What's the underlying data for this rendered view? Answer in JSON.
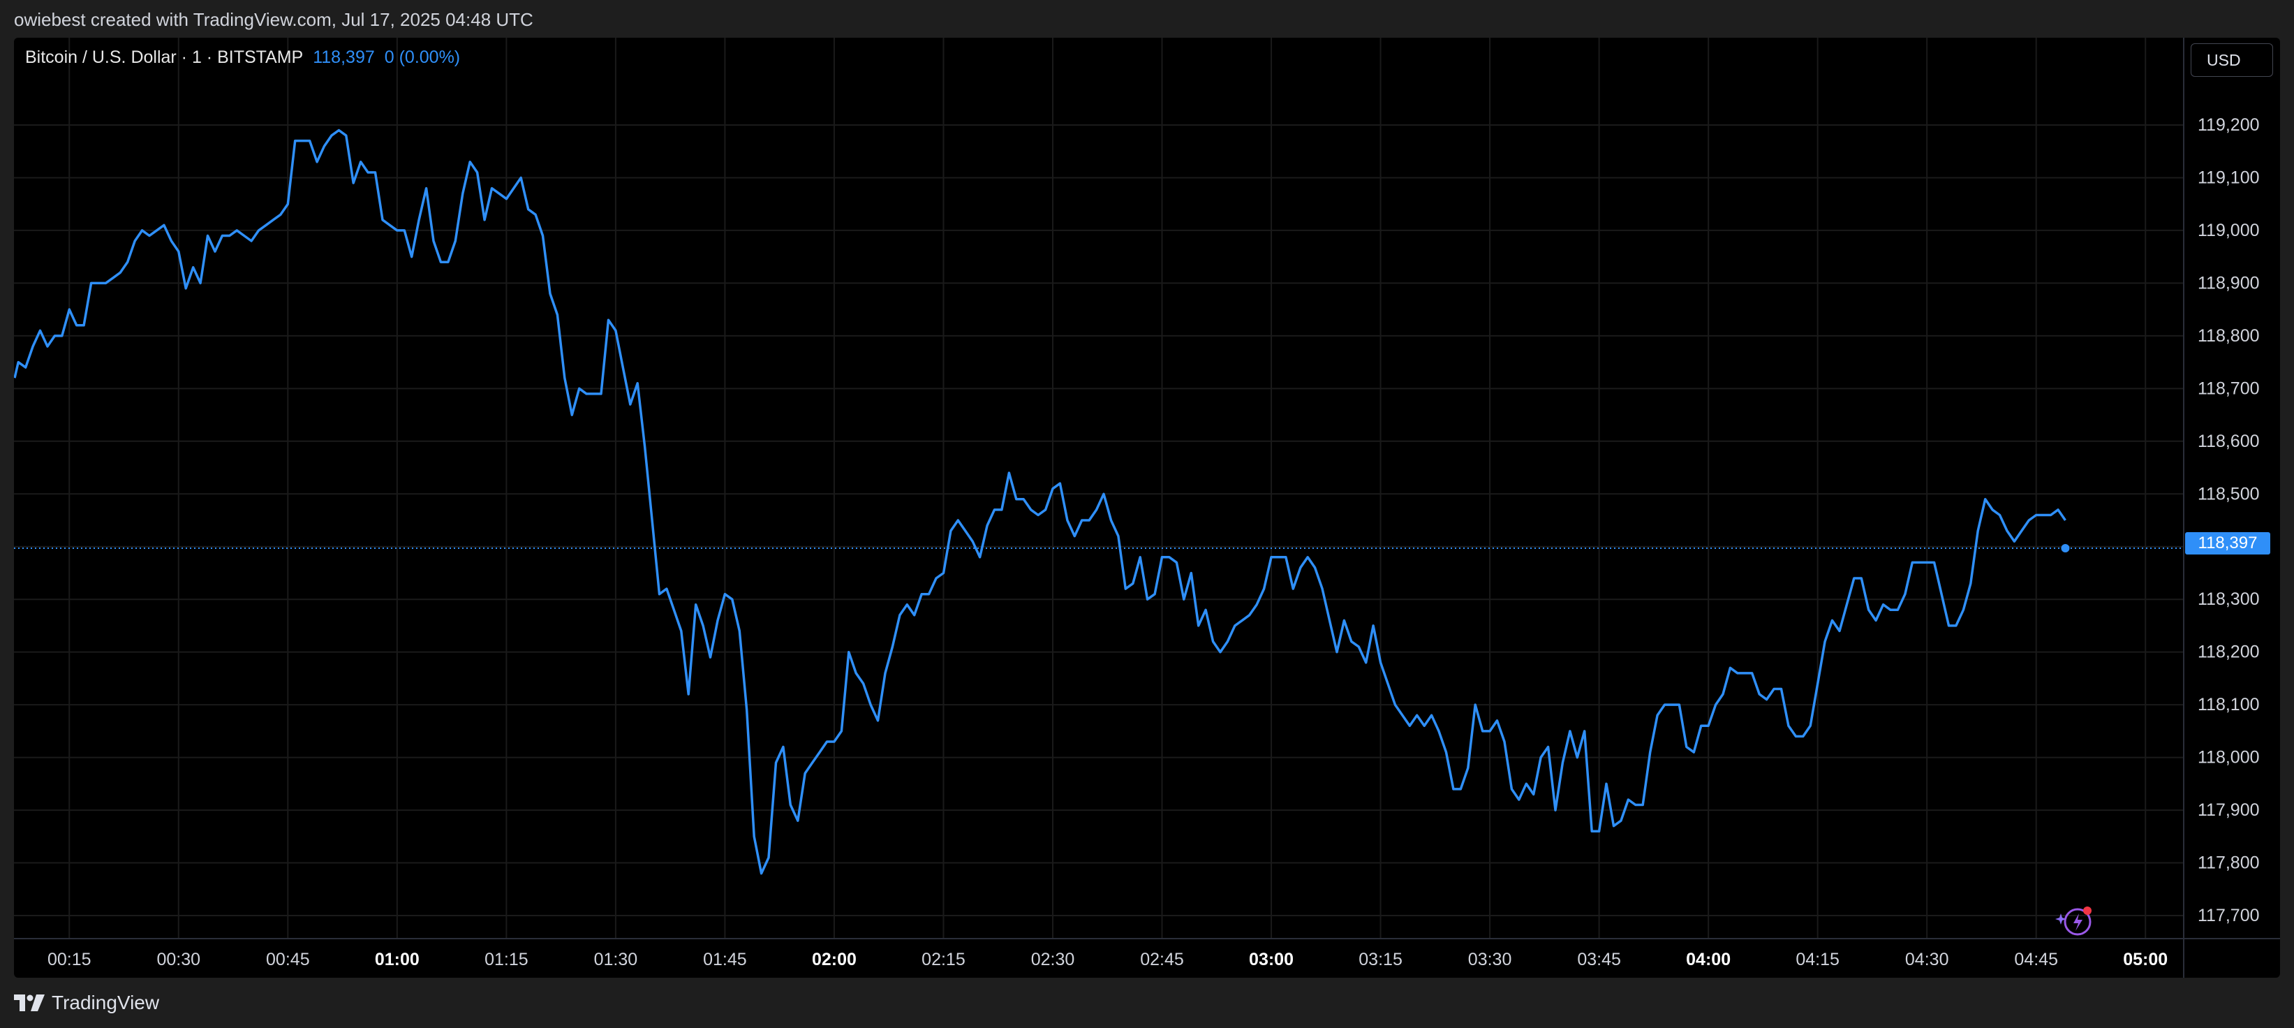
{
  "header": {
    "credit": "owiebest created with TradingView.com, Jul 17, 2025 04:48 UTC"
  },
  "legend": {
    "symbol": "Bitcoin / U.S. Dollar · 1 · BITSTAMP",
    "last_price": "118,397",
    "change": "0 (0.00%)"
  },
  "scale": {
    "currency": "USD",
    "current_price_label": "118,397"
  },
  "footer": {
    "brand": "TradingView"
  },
  "icons": [
    "tradingview-logo-icon",
    "ai-assistant-icon"
  ],
  "colors": {
    "line": "#2f8ff8",
    "background": "#000000",
    "grid": "#1a1a1a",
    "price_tag": "#2f8ff8"
  },
  "chart_data": {
    "type": "line",
    "ylim": [
      117650,
      119250
    ],
    "y_ticks": [
      117700,
      117800,
      117900,
      118000,
      118100,
      118200,
      118300,
      118400,
      118500,
      118600,
      118700,
      118800,
      118900,
      119000,
      119100,
      119200
    ],
    "y_tick_labels": [
      "117,700",
      "117,800",
      "117,900",
      "118,000",
      "118,100",
      "118,200",
      "118,300",
      "118,400",
      "118,500",
      "118,600",
      "118,700",
      "118,800",
      "118,900",
      "119,000",
      "119,100",
      "119,200"
    ],
    "x_tick_labels": [
      {
        "label": "00:15",
        "minute": 15,
        "bold": false
      },
      {
        "label": "00:30",
        "minute": 30,
        "bold": false
      },
      {
        "label": "00:45",
        "minute": 45,
        "bold": false
      },
      {
        "label": "01:00",
        "minute": 60,
        "bold": true
      },
      {
        "label": "01:15",
        "minute": 75,
        "bold": false
      },
      {
        "label": "01:30",
        "minute": 90,
        "bold": false
      },
      {
        "label": "01:45",
        "minute": 105,
        "bold": false
      },
      {
        "label": "02:00",
        "minute": 120,
        "bold": true
      },
      {
        "label": "02:15",
        "minute": 135,
        "bold": false
      },
      {
        "label": "02:30",
        "minute": 150,
        "bold": false
      },
      {
        "label": "02:45",
        "minute": 165,
        "bold": false
      },
      {
        "label": "03:00",
        "minute": 180,
        "bold": true
      },
      {
        "label": "03:15",
        "minute": 195,
        "bold": false
      },
      {
        "label": "03:30",
        "minute": 210,
        "bold": false
      },
      {
        "label": "03:45",
        "minute": 225,
        "bold": false
      },
      {
        "label": "04:00",
        "minute": 240,
        "bold": true
      },
      {
        "label": "04:15",
        "minute": 255,
        "bold": false
      },
      {
        "label": "04:30",
        "minute": 270,
        "bold": false
      },
      {
        "label": "04:45",
        "minute": 285,
        "bold": false
      },
      {
        "label": "05:00",
        "minute": 300,
        "bold": true
      }
    ],
    "xlim_minutes": [
      7.5,
      305
    ],
    "current_price": 118397,
    "series": [
      {
        "x_minutes": [
          7.5,
          8,
          9,
          10,
          11,
          12,
          13,
          14,
          15,
          16,
          17,
          18,
          19,
          20,
          21,
          22,
          23,
          24,
          25,
          26,
          27,
          28,
          29,
          30,
          31,
          32,
          33,
          34,
          35,
          36,
          37,
          38,
          39,
          40,
          41,
          42,
          43,
          44,
          45,
          46,
          47,
          48,
          49,
          50,
          51,
          52,
          53,
          54,
          55,
          56,
          57,
          58,
          59,
          60,
          61,
          62,
          63,
          64,
          65,
          66,
          67,
          68,
          69,
          70,
          71,
          72,
          73,
          74,
          75,
          76,
          77,
          78,
          79,
          80,
          81,
          82,
          83,
          84,
          85,
          86,
          87,
          88,
          89,
          90,
          91,
          92,
          93,
          94,
          95,
          96,
          97,
          98,
          99,
          100,
          101,
          102,
          103,
          104,
          105,
          106,
          107,
          108,
          109,
          110,
          111,
          112,
          113,
          114,
          115,
          116,
          117,
          118,
          119,
          120,
          121,
          122,
          123,
          124,
          125,
          126,
          127,
          128,
          129,
          130,
          131,
          132,
          133,
          134,
          135,
          136,
          137,
          138,
          139,
          140,
          141,
          142,
          143,
          144,
          145,
          146,
          147,
          148,
          149,
          150,
          151,
          152,
          153,
          154,
          155,
          156,
          157,
          158,
          159,
          160,
          161,
          162,
          163,
          164,
          165,
          166,
          167,
          168,
          169,
          170,
          171,
          172,
          173,
          174,
          175,
          176,
          177,
          178,
          179,
          180,
          181,
          182,
          183,
          184,
          185,
          186,
          187,
          188,
          189,
          190,
          191,
          192,
          193,
          194,
          195,
          196,
          197,
          198,
          199,
          200,
          201,
          202,
          203,
          204,
          205,
          206,
          207,
          208,
          209,
          210,
          211,
          212,
          213,
          214,
          215,
          216,
          217,
          218,
          219,
          220,
          221,
          222,
          223,
          224,
          225,
          226,
          227,
          228,
          229,
          230,
          231,
          232,
          233,
          234,
          235,
          236,
          237,
          238,
          239,
          240,
          241,
          242,
          243,
          244,
          245,
          246,
          247,
          248,
          249,
          250,
          251,
          252,
          253,
          254,
          255,
          256,
          257,
          258,
          259,
          260,
          261,
          262,
          263,
          264,
          265,
          266,
          267,
          268,
          269,
          270,
          271,
          272,
          273,
          274,
          275,
          276,
          277,
          278,
          279,
          280,
          281,
          282,
          283,
          284,
          285,
          286,
          287,
          288,
          289
        ],
        "values": [
          118720,
          118750,
          118740,
          118780,
          118810,
          118780,
          118800,
          118800,
          118850,
          118820,
          118820,
          118900,
          118900,
          118900,
          118910,
          118920,
          118940,
          118980,
          119000,
          118990,
          119000,
          119010,
          118980,
          118960,
          118890,
          118930,
          118900,
          118990,
          118960,
          118990,
          118990,
          119000,
          118990,
          118980,
          119000,
          119010,
          119020,
          119030,
          119050,
          119170,
          119170,
          119170,
          119130,
          119160,
          119180,
          119190,
          119180,
          119090,
          119130,
          119110,
          119110,
          119020,
          119010,
          119000,
          119000,
          118950,
          119020,
          119080,
          118980,
          118940,
          118940,
          118980,
          119070,
          119130,
          119110,
          119020,
          119080,
          119070,
          119060,
          119080,
          119100,
          119040,
          119030,
          118990,
          118880,
          118840,
          118720,
          118650,
          118700,
          118690,
          118690,
          118690,
          118830,
          118810,
          118740,
          118670,
          118710,
          118590,
          118450,
          118310,
          118320,
          118280,
          118240,
          118120,
          118290,
          118250,
          118190,
          118260,
          118310,
          118300,
          118240,
          118090,
          117850,
          117780,
          117810,
          117990,
          118020,
          117910,
          117880,
          117970,
          117990,
          118010,
          118030,
          118030,
          118050,
          118200,
          118160,
          118140,
          118100,
          118070,
          118160,
          118210,
          118270,
          118290,
          118270,
          118310,
          118310,
          118340,
          118350,
          118430,
          118450,
          118430,
          118410,
          118380,
          118440,
          118470,
          118470,
          118540,
          118490,
          118490,
          118470,
          118460,
          118470,
          118510,
          118520,
          118450,
          118420,
          118450,
          118450,
          118470,
          118500,
          118450,
          118420,
          118320,
          118330,
          118380,
          118300,
          118310,
          118380,
          118380,
          118370,
          118300,
          118350,
          118250,
          118280,
          118220,
          118200,
          118220,
          118250,
          118260,
          118270,
          118290,
          118320,
          118380,
          118380,
          118380,
          118320,
          118360,
          118380,
          118360,
          118320,
          118260,
          118200,
          118260,
          118220,
          118210,
          118180,
          118250,
          118180,
          118140,
          118100,
          118080,
          118060,
          118080,
          118060,
          118080,
          118050,
          118010,
          117940,
          117940,
          117980,
          118100,
          118050,
          118050,
          118070,
          118030,
          117940,
          117920,
          117950,
          117930,
          118000,
          118020,
          117900,
          117990,
          118050,
          118000,
          118050,
          117860,
          117860,
          117950,
          117870,
          117880,
          117920,
          117910,
          117910,
          118010,
          118080,
          118100,
          118100,
          118100,
          118020,
          118010,
          118060,
          118060,
          118100,
          118120,
          118170,
          118160,
          118160,
          118160,
          118120,
          118110,
          118130,
          118130,
          118060,
          118040,
          118040,
          118060,
          118140,
          118220,
          118260,
          118240,
          118290,
          118340,
          118340,
          118280,
          118260,
          118290,
          118280,
          118280,
          118310,
          118370,
          118370,
          118370,
          118370,
          118310,
          118250,
          118250,
          118280,
          118330,
          118430,
          118490,
          118470,
          118460,
          118430,
          118410,
          118430,
          118450,
          118460,
          118460,
          118460,
          118470,
          118450,
          118420,
          118430,
          118400,
          118397
        ]
      }
    ]
  }
}
